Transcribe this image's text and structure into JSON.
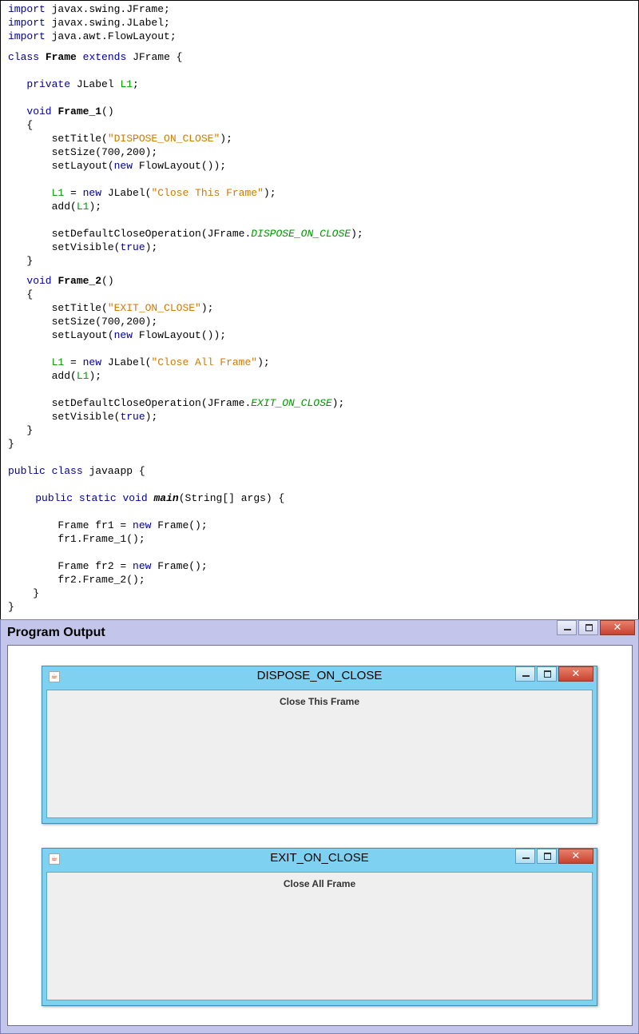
{
  "code": {
    "lines": [
      [
        [
          "kw",
          "import"
        ],
        [
          "t",
          " javax.swing.JFrame;"
        ]
      ],
      [
        [
          "kw",
          "import"
        ],
        [
          "t",
          " javax.swing.JLabel;"
        ]
      ],
      [
        [
          "kw",
          "import"
        ],
        [
          "t",
          " java.awt.FlowLayout;"
        ]
      ],
      [
        [
          "kw",
          "class"
        ],
        [
          "t",
          " "
        ],
        [
          "b",
          "Frame"
        ],
        [
          "t",
          " "
        ],
        [
          "kw",
          "extends"
        ],
        [
          "t",
          " JFrame {"
        ]
      ],
      [
        [
          "t",
          "   "
        ],
        [
          "kw",
          "private"
        ],
        [
          "t",
          " JLabel "
        ],
        [
          "g",
          "L1"
        ],
        [
          "t",
          ";"
        ]
      ],
      [
        [
          "t",
          "   "
        ],
        [
          "kw",
          "void"
        ],
        [
          "t",
          " "
        ],
        [
          "b",
          "Frame_1"
        ],
        [
          "t",
          "()"
        ]
      ],
      [
        [
          "t",
          "   {"
        ]
      ],
      [
        [
          "t",
          "       setTitle("
        ],
        [
          "s",
          "\"DISPOSE_ON_CLOSE\""
        ],
        [
          "t",
          ");"
        ]
      ],
      [
        [
          "t",
          "       setSize(700,200);"
        ]
      ],
      [
        [
          "t",
          "       setLayout("
        ],
        [
          "kw",
          "new"
        ],
        [
          "t",
          " FlowLayout());"
        ]
      ],
      [
        [
          "t",
          "       "
        ],
        [
          "g",
          "L1"
        ],
        [
          "t",
          " = "
        ],
        [
          "kw",
          "new"
        ],
        [
          "t",
          " JLabel("
        ],
        [
          "s",
          "\"Close This Frame\""
        ],
        [
          "t",
          ");"
        ]
      ],
      [
        [
          "t",
          "       add("
        ],
        [
          "g",
          "L1"
        ],
        [
          "t",
          ");"
        ]
      ],
      [
        [
          "t",
          "       setDefaultCloseOperation(JFrame."
        ],
        [
          "gi",
          "DISPOSE_ON_CLOSE"
        ],
        [
          "t",
          ");"
        ]
      ],
      [
        [
          "t",
          "       setVisible("
        ],
        [
          "kw",
          "true"
        ],
        [
          "t",
          ");"
        ]
      ],
      [
        [
          "t",
          "   }"
        ]
      ],
      [
        [
          "t",
          "   "
        ],
        [
          "kw",
          "void"
        ],
        [
          "t",
          " "
        ],
        [
          "b",
          "Frame_2"
        ],
        [
          "t",
          "()"
        ]
      ],
      [
        [
          "t",
          "   {"
        ]
      ],
      [
        [
          "t",
          "       setTitle("
        ],
        [
          "s",
          "\"EXIT_ON_CLOSE\""
        ],
        [
          "t",
          ");"
        ]
      ],
      [
        [
          "t",
          "       setSize(700,200);"
        ]
      ],
      [
        [
          "t",
          "       setLayout("
        ],
        [
          "kw",
          "new"
        ],
        [
          "t",
          " FlowLayout());"
        ]
      ],
      [
        [
          "t",
          "       "
        ],
        [
          "g",
          "L1"
        ],
        [
          "t",
          " = "
        ],
        [
          "kw",
          "new"
        ],
        [
          "t",
          " JLabel("
        ],
        [
          "s",
          "\"Close All Frame\""
        ],
        [
          "t",
          ");"
        ]
      ],
      [
        [
          "t",
          "       add("
        ],
        [
          "g",
          "L1"
        ],
        [
          "t",
          ");"
        ]
      ],
      [
        [
          "t",
          "       setDefaultCloseOperation(JFrame."
        ],
        [
          "gi",
          "EXIT_ON_CLOSE"
        ],
        [
          "t",
          ");"
        ]
      ],
      [
        [
          "t",
          "       setVisible("
        ],
        [
          "kw",
          "true"
        ],
        [
          "t",
          ");"
        ]
      ],
      [
        [
          "t",
          "   }"
        ]
      ],
      [
        [
          "t",
          "}"
        ]
      ],
      [
        [
          "kw",
          "public"
        ],
        [
          "t",
          " "
        ],
        [
          "kw",
          "class"
        ],
        [
          "t",
          " javaapp {"
        ]
      ],
      [
        [
          "t",
          "    "
        ],
        [
          "kw",
          "public"
        ],
        [
          "t",
          " "
        ],
        [
          "kw",
          "static"
        ],
        [
          "t",
          " "
        ],
        [
          "kw",
          "void"
        ],
        [
          "t",
          " "
        ],
        [
          "bi",
          "main"
        ],
        [
          "t",
          "(String[] args) {"
        ]
      ],
      [
        [
          "t",
          "        Frame fr1 = "
        ],
        [
          "kw",
          "new"
        ],
        [
          "t",
          " Frame();"
        ]
      ],
      [
        [
          "t",
          "        fr1.Frame_1();"
        ]
      ],
      [
        [
          "t",
          "        Frame fr2 = "
        ],
        [
          "kw",
          "new"
        ],
        [
          "t",
          " Frame();"
        ]
      ],
      [
        [
          "t",
          "        fr2.Frame_2();"
        ]
      ],
      [
        [
          "t",
          "    }"
        ]
      ],
      [
        [
          "t",
          "}"
        ]
      ]
    ]
  },
  "output": {
    "title": "Program Output",
    "frames": [
      {
        "title": "DISPOSE_ON_CLOSE",
        "label": "Close This Frame"
      },
      {
        "title": "EXIT_ON_CLOSE",
        "label": "Close All Frame"
      }
    ]
  },
  "colors": {
    "keyword": "#000099",
    "string": "#ce7b00",
    "identifier": "#009900",
    "output_window": "#c3c6ea",
    "frame_title_bar": "#7fd1f1",
    "close_button": "#c84330"
  },
  "icons": {
    "window_minimize": "minimize-icon",
    "window_maximize": "maximize-icon",
    "window_close": "close-icon",
    "java_app": "java-cup-icon"
  }
}
